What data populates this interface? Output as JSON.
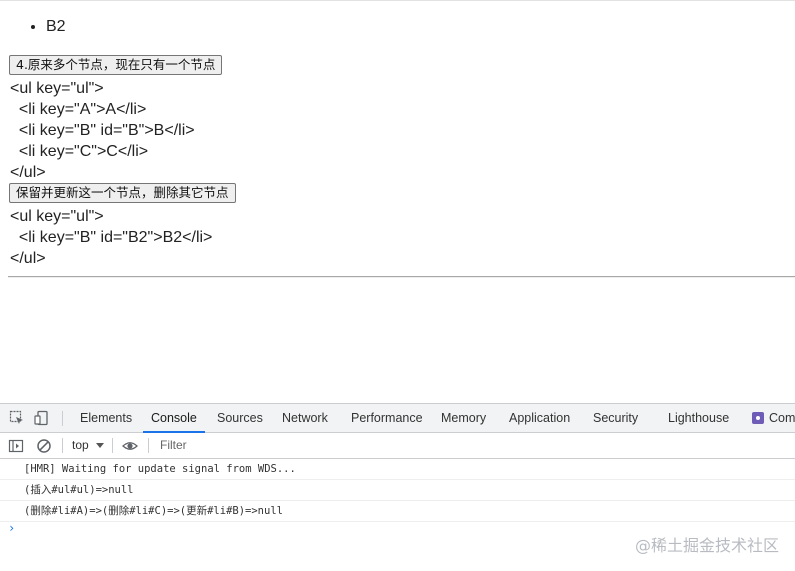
{
  "page": {
    "list_item": "B2",
    "button1_label": "4.原来多个节点，现在只有一个节点",
    "code1": "<ul key=\"ul\">\n  <li key=\"A\">A</li>\n  <li key=\"B\" id=\"B\">B</li>\n  <li key=\"C\">C</li>\n</ul>",
    "button2_label": "保留并更新这一个节点，删除其它节点",
    "code2": "<ul key=\"ul\">\n  <li key=\"B\" id=\"B2\">B2</li>\n</ul>"
  },
  "devtools": {
    "tabs": [
      "Elements",
      "Console",
      "Sources",
      "Network",
      "Performance",
      "Memory",
      "Application",
      "Security",
      "Lighthouse",
      "Com"
    ],
    "active_tab": "Console",
    "context": "top",
    "filter_placeholder": "Filter",
    "messages": [
      "[HMR] Waiting for update signal from WDS...",
      "(插入#ul#ul)=>null",
      "(删除#li#A)=>(删除#li#C)=>(更新#li#B)=>null"
    ],
    "prompt": "›",
    "icons": [
      "inspect-icon",
      "device-toggle-icon",
      "sidebar-toggle-icon",
      "clear-console-icon",
      "eye-icon",
      "extension-icon"
    ],
    "accent_color": "#1a73e8"
  },
  "watermark": "@稀土掘金技术社区"
}
